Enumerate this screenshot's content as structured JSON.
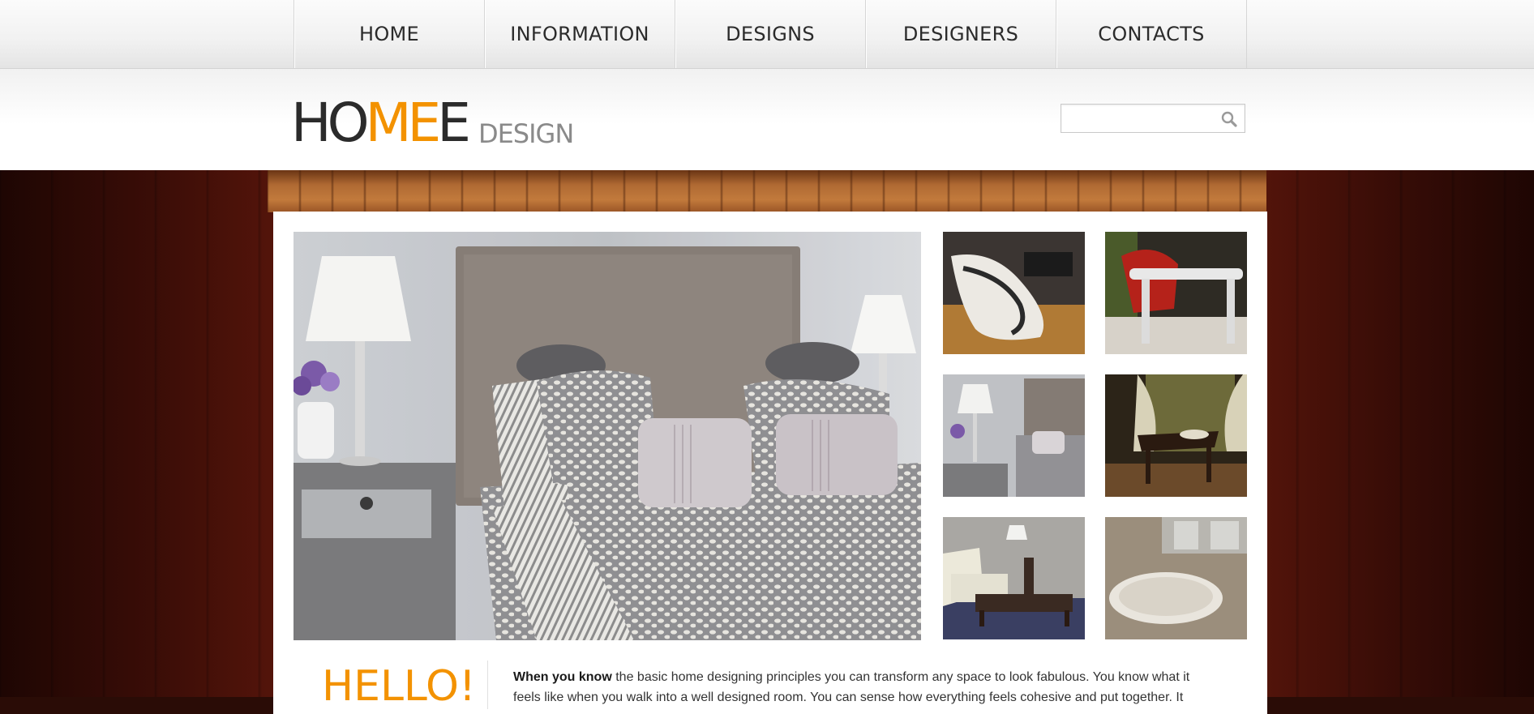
{
  "nav": {
    "items": [
      {
        "label": "HOME"
      },
      {
        "label": "INFORMATION"
      },
      {
        "label": "DESIGNS"
      },
      {
        "label": "DESIGNERS"
      },
      {
        "label": "CONTACTS"
      }
    ]
  },
  "header": {
    "logo": {
      "part1": "HO",
      "accent": "ME",
      "part2": "E",
      "sub": "DESIGN"
    },
    "search": {
      "placeholder": "",
      "value": ""
    }
  },
  "colors": {
    "accent": "#f39200",
    "text": "#2b2b2b",
    "logo_sub": "#8a8a8a"
  },
  "gallery": {
    "hero": {
      "alt": "bedroom with gray headboard and lamps"
    },
    "thumbs": [
      {
        "alt": "white lounge chair"
      },
      {
        "alt": "red chair and white table"
      },
      {
        "alt": "bedroom"
      },
      {
        "alt": "window with curtains and chair"
      },
      {
        "alt": "living room sofa"
      },
      {
        "alt": "bathtub"
      }
    ]
  },
  "intro": {
    "heading": "HELLO!",
    "lead": "When you know",
    "line1": " the basic home designing principles you can transform any space to look fabulous. You know what it",
    "line2": "feels like when you walk into a well designed room. You can sense how everything feels cohesive and put together. It"
  },
  "icons": {
    "search": "search-icon"
  }
}
